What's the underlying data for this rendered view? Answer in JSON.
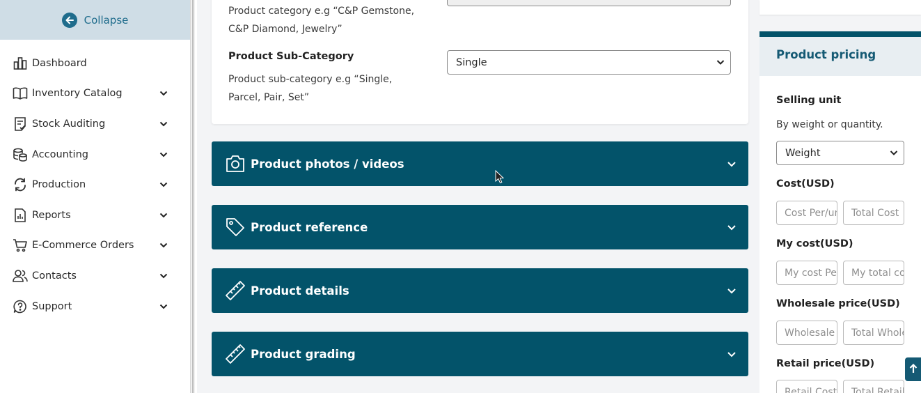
{
  "sidebar": {
    "collapse_label": "Collapse",
    "items": [
      {
        "label": "Dashboard",
        "icon": "dashboard-icon"
      },
      {
        "label": "Inventory Catalog",
        "icon": "book-icon"
      },
      {
        "label": "Stock Auditing",
        "icon": "checklist-icon"
      },
      {
        "label": "Accounting",
        "icon": "coins-icon"
      },
      {
        "label": "Production",
        "icon": "refresh-icon"
      },
      {
        "label": "Reports",
        "icon": "report-icon"
      },
      {
        "label": "E-Commerce Orders",
        "icon": "cart-icon"
      },
      {
        "label": "Contacts",
        "icon": "users-icon"
      },
      {
        "label": "Support",
        "icon": "help-icon"
      }
    ]
  },
  "main": {
    "category_help_1": "Product category e.g “C&P Gemstone,",
    "category_help_2": "C&P Diamond, Jewelry”",
    "subcategory_label": "Product Sub-Category",
    "subcategory_help_1": "Product sub-category e.g “Single,",
    "subcategory_help_2": "Parcel, Pair, Set”",
    "subcategory_value": "Single",
    "accordions": [
      {
        "label": "Product photos / videos",
        "icon": "camera-icon"
      },
      {
        "label": "Product reference",
        "icon": "tag-icon"
      },
      {
        "label": "Product details",
        "icon": "ruler-icon"
      },
      {
        "label": "Product grading",
        "icon": "ruler-icon"
      }
    ]
  },
  "pricing": {
    "title": "Product pricing",
    "selling_unit_label": "Selling unit",
    "selling_unit_help": "By weight or quantity.",
    "selling_unit_value": "Weight",
    "cost_label": "Cost(USD)",
    "cost_per_placeholder": "Cost Per/unit",
    "cost_total_placeholder": "Total Cost",
    "my_cost_label": "My cost(USD)",
    "my_cost_per_placeholder": "My cost Per/unit",
    "my_cost_total_placeholder": "My total cost",
    "wholesale_label": "Wholesale price(USD)",
    "wholesale_per_placeholder": "Wholesale Per/unit",
    "wholesale_total_placeholder": "Total Wholesale",
    "retail_label": "Retail price(USD)",
    "retail_per_placeholder": "Retail Cost",
    "retail_total_placeholder": "Total Retail"
  },
  "colors": {
    "accent": "#03536a",
    "sidebar_header": "#cfdde6",
    "link": "#1f6c8c"
  }
}
